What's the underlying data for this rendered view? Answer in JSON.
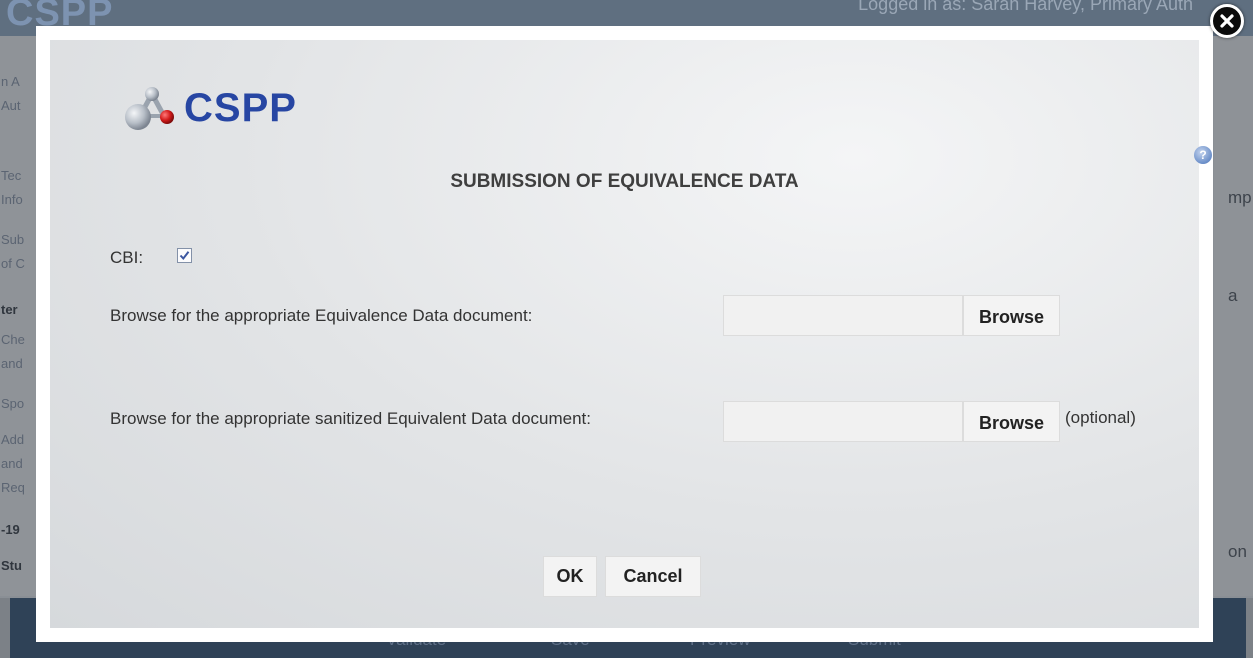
{
  "background": {
    "logo": "CSPP",
    "user_text": "Logged in as: Sarah Harvey, Primary Auth",
    "left_items": [
      "n A",
      "Aut",
      "Tec",
      "Info",
      "Sub",
      "of C",
      "ter",
      "Che",
      "and",
      "Spo",
      "Add",
      "and",
      "Req",
      "-19",
      "Stu"
    ],
    "right_items": [
      "mp",
      "a",
      "on"
    ],
    "footer_buttons": [
      "Validate",
      "Save",
      "Preview",
      "Submit"
    ]
  },
  "modal": {
    "logo_text": "CSPP",
    "help_symbol": "?",
    "title": "SUBMISSION OF EQUIVALENCE DATA",
    "cbi_label": "CBI:",
    "cbi_checked": true,
    "doc1_label": "Browse for the appropriate Equivalence Data document:",
    "doc1_value": "",
    "doc1_browse": "Browse",
    "doc2_label": "Browse for the appropriate sanitized Equivalent Data document:",
    "doc2_value": "",
    "doc2_browse": "Browse",
    "doc2_optional": "(optional)",
    "ok_label": "OK",
    "cancel_label": "Cancel"
  },
  "colors": {
    "brand": "#2746a3",
    "overlay": "#8a8f95"
  },
  "icons": {
    "close": "close-icon",
    "help": "help-icon",
    "logo": "molecule-logo-icon",
    "check": "checkmark-icon"
  }
}
